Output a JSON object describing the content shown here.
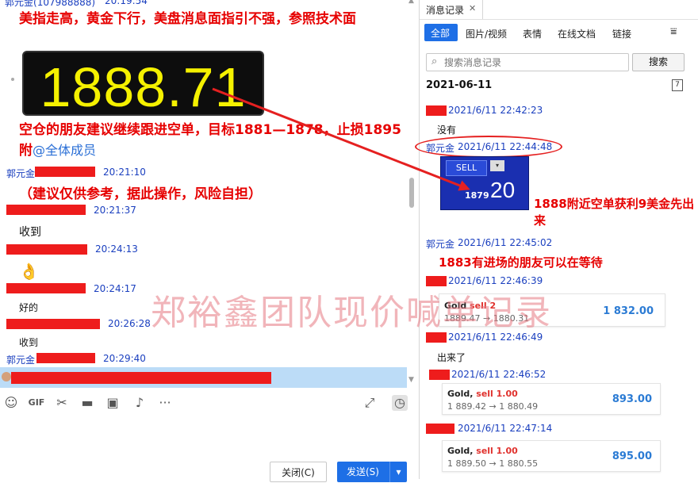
{
  "left": {
    "header_sender": "郭元金",
    "header_id": "107988888",
    "header_time": "20:19:54",
    "note1": "美指走高，黄金下行，美盘消息面指引不强，参照技术面",
    "price": "1888.71",
    "note2": "空仓的朋友建议继续跟进空单，目标1881—1878，止损1895附",
    "mention": "@全体成员",
    "note3": "（建议仅供参考，据此操作，风险自担）",
    "messages": [
      {
        "sender": "郭元金",
        "time": "20:21:10"
      },
      {
        "time": "20:21:37",
        "text": "收到"
      },
      {
        "time": "20:24:13",
        "emoji": "👌"
      },
      {
        "time": "20:24:17",
        "text": "好的"
      },
      {
        "time": "20:26:28",
        "text": "收到"
      },
      {
        "sender": "郭元金",
        "time": "20:29:40"
      }
    ]
  },
  "watermark": "郑裕鑫团队现价喊单记录",
  "buttons": {
    "close": "关闭(C)",
    "send": "发送(S)",
    "send_arrow": "▾"
  },
  "right": {
    "title": "消息记录",
    "close_glyph": "✕",
    "tabs": [
      "全部",
      "图片/视频",
      "表情",
      "在线文档",
      "链接"
    ],
    "search_placeholder": "搜索消息记录",
    "search_button": "搜索",
    "date": "2021-06-11",
    "calendar_glyph": "7",
    "entries": [
      {
        "time": "2021/6/11 22:42:23",
        "text": "没有"
      },
      {
        "sender": "郭元金",
        "time": "2021/6/11 22:44:48"
      },
      {
        "sender": "郭元金",
        "time": "2021/6/11 22:45:02"
      },
      {
        "time": "2021/6/11 22:46:39"
      },
      {
        "time": "2021/6/11 22:46:49",
        "text": "出来了"
      },
      {
        "time": "2021/6/11 22:46:52"
      },
      {
        "time": "2021/6/11 22:47:14"
      }
    ],
    "sell_btn": "SELL",
    "sell_lot": "1879",
    "sell_big": "20",
    "note_a": "1888附近空单获利9美金先出来",
    "note_b": "1883有进场的朋友可以在等待",
    "card1": {
      "name": "Gold",
      "side": "sell 2",
      "range": "1889.47 → 1880.31",
      "price": "1 832.00"
    },
    "card2": {
      "name": "Gold,",
      "side": "sell 1.00",
      "range": "1 889.42 → 1 880.49",
      "price": "893.00"
    },
    "card3": {
      "name": "Gold,",
      "side": "sell 1.00",
      "range": "1 889.50 → 1 880.55",
      "price": "895.00"
    }
  },
  "colors": {
    "accent": "#1e6fe6",
    "red": "#e60000",
    "link": "#1a3fbf"
  }
}
